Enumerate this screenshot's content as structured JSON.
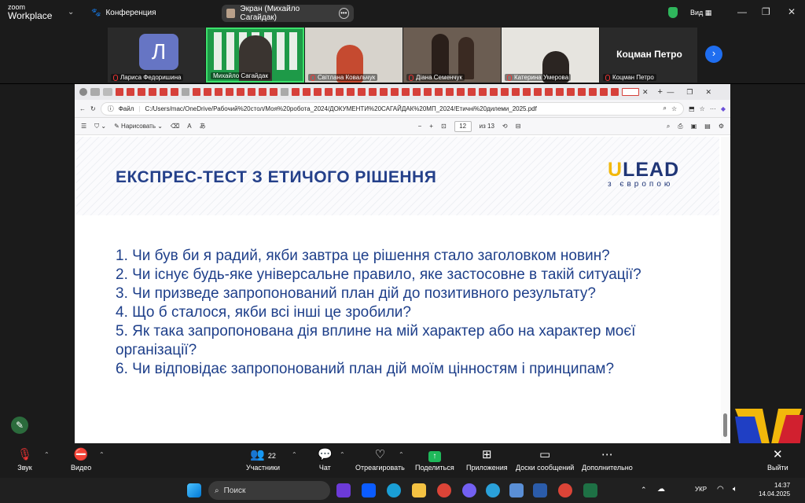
{
  "app": {
    "logo_top": "zoom",
    "logo_bottom": "Workplace",
    "meeting_title": "Конференция"
  },
  "share": {
    "label": "Экран (Михайло Сагайдак)"
  },
  "view": {
    "label": "Вид"
  },
  "participants": [
    {
      "name": "Лариса Федоришина",
      "initial": "Л"
    },
    {
      "name": "Михайло Сагайдак"
    },
    {
      "name": "Світлана Ковальчук"
    },
    {
      "name": "Діана Семенчук"
    },
    {
      "name": "Катерина Умерова"
    },
    {
      "name": "Коцман Петро",
      "big": "Коцман Петро"
    }
  ],
  "browser": {
    "url_prefix": "Файл",
    "url": "C:/Users/mac/OneDrive/Рабочий%20стол/Моя%20робота_2024/ДОКУМЕНТИ%20САГАЙДАК%20МП_2024/Етичні%20дилеми_2025.pdf",
    "draw_label": "Нарисовать",
    "page_current": "12",
    "page_total": "из 13"
  },
  "slide": {
    "title": "ЕКСПРЕС-ТЕСТ З ЕТИЧОГО РІШЕННЯ",
    "brand_u": "U",
    "brand_rest": "LEAD",
    "brand_sub": "з європою",
    "questions": [
      "1. Чи був би я радий, якби завтра це рішення стало заголовком новин?",
      "2. Чи існує будь-яке універсальне правило, яке застосовне в такій ситуації?",
      "3. Чи призведе запропонований план дій до позитивного результату?",
      "4. Що б сталося, якби всі інші це зробили?",
      "5. Як така запропонована дія вплине на мій характер або на характер моєї організації?",
      "6. Чи відповідає запропонований план дій моїм цінностям і принципам?"
    ]
  },
  "toolbar": {
    "audio": "Звук",
    "video": "Видео",
    "participants": "Участники",
    "participants_count": "22",
    "chat": "Чат",
    "react": "Отреагировать",
    "share": "Поделиться",
    "apps": "Приложения",
    "whiteboards": "Доски сообщений",
    "more": "Дополнительно",
    "leave": "Выйти"
  },
  "taskbar": {
    "search_placeholder": "Поиск",
    "lang": "УКР",
    "time": "14:37",
    "date": "14.04.2025"
  },
  "colors": {
    "slide_text": "#1e3f8a",
    "brand_yellow": "#f2b80b",
    "zoom_blue": "#1f6ef0"
  }
}
